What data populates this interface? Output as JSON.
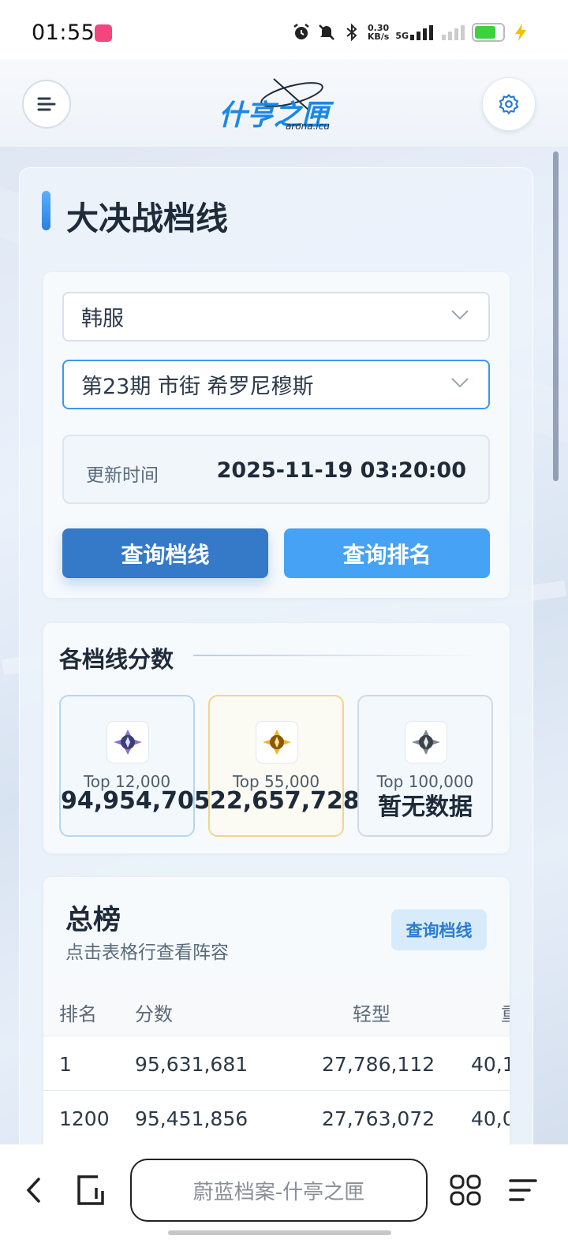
{
  "status_bar": {
    "time": "01:55",
    "net_speed_value": "0.30",
    "net_speed_unit": "KB/s",
    "network_type": "5G",
    "battery_level": 0.75
  },
  "header": {
    "logo_text": "什亨之匣",
    "logo_sub": "arona.icu",
    "menu_icon": "menu-icon",
    "settings_icon": "gear-icon"
  },
  "page": {
    "title": "大决战档线",
    "server_select": "韩服",
    "season_select": "第23期 市街 希罗尼穆斯",
    "update_label": "更新时间",
    "update_value": "2025-11-19 03:20:00",
    "btn_query_line": "查询档线",
    "btn_query_rank": "查询排名"
  },
  "tiers": {
    "title": "各档线分数",
    "items": [
      {
        "label": "Top 12,000",
        "value": "94,954,705",
        "icon": "platinum-medal-icon"
      },
      {
        "label": "Top 55,000",
        "value": "22,657,728",
        "icon": "gold-medal-icon"
      },
      {
        "label": "Top 100,000",
        "value": "暂无数据",
        "icon": "silver-medal-icon"
      }
    ]
  },
  "ranking": {
    "title": "总榜",
    "subtitle": "点击表格行查看阵容",
    "button": "查询档线",
    "columns": [
      "排名",
      "分数",
      "轻型",
      "重"
    ],
    "rows": [
      [
        "1",
        "95,631,681",
        "27,786,112",
        "40,1"
      ],
      [
        "1200",
        "95,451,856",
        "27,763,072",
        "40,0"
      ]
    ]
  },
  "browser": {
    "url_text": "蔚蓝档案-什亭之匣",
    "icons": [
      "back-icon",
      "tabs-icon",
      "apps-icon",
      "menu-icon"
    ]
  },
  "colors": {
    "primary": "#3579c9",
    "secondary": "#45a2f5",
    "accent_blue": "#1b88e6",
    "gold": "#f3d58a"
  }
}
